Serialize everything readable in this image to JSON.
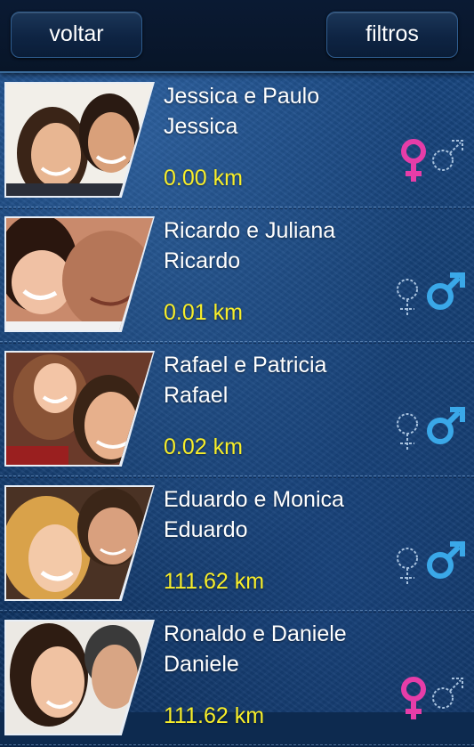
{
  "header": {
    "back_label": "voltar",
    "filter_label": "filtros"
  },
  "list": {
    "items": [
      {
        "title": "Jessica e Paulo",
        "subtitle": "Jessica",
        "distance": "0.00 km",
        "active_gender": "female"
      },
      {
        "title": "Ricardo e Juliana",
        "subtitle": "Ricardo",
        "distance": "0.01 km",
        "active_gender": "male"
      },
      {
        "title": "Rafael e Patricia",
        "subtitle": "Rafael",
        "distance": "0.02 km",
        "active_gender": "male"
      },
      {
        "title": "Eduardo e Monica",
        "subtitle": "Eduardo",
        "distance": "111.62 km",
        "active_gender": "male"
      },
      {
        "title": "Ronaldo e Daniele",
        "subtitle": "Daniele",
        "distance": "111.62 km",
        "active_gender": "female"
      }
    ]
  },
  "colors": {
    "distance": "#f7ee2a",
    "female_active": "#e63da8",
    "male_active": "#3aa8e8",
    "inactive_outline": "#a8c2de"
  },
  "icons": [
    "female-symbol-icon",
    "male-symbol-icon"
  ]
}
